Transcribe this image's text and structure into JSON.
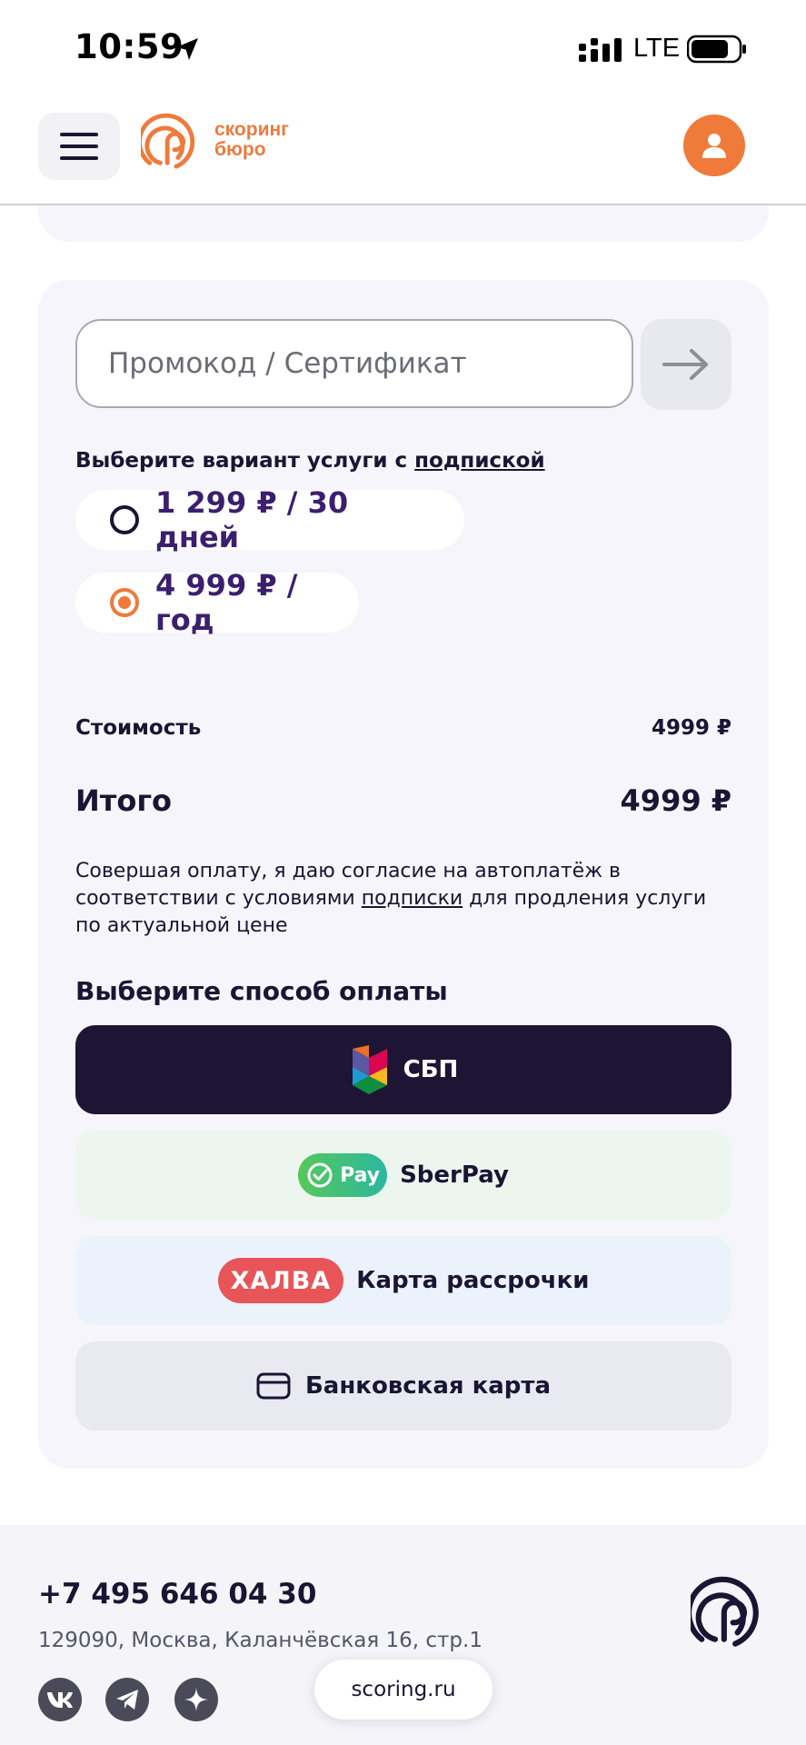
{
  "status_bar": {
    "time": "10:59",
    "network": "LTE"
  },
  "header": {
    "logo_line1": "скоринг",
    "logo_line2": "бюро"
  },
  "promo": {
    "placeholder": "Промокод / Сертификат"
  },
  "plans": {
    "label_prefix": "Выберите вариант услуги с ",
    "label_link": "подпиской",
    "options": [
      {
        "label": "1 299 ₽ / 30 дней",
        "selected": false
      },
      {
        "label": "4 999 ₽ / год",
        "selected": true
      }
    ]
  },
  "summary": {
    "cost_label": "Стоимость",
    "cost_value": "4999 ₽",
    "total_label": "Итого",
    "total_value": "4999 ₽"
  },
  "consent": {
    "part1": "Совершая оплату, я даю согласие на автоплатёж в соответствии с условиями ",
    "link": "подписки",
    "part2": " для продления услуги по актуальной цене"
  },
  "payment": {
    "title": "Выберите способ оплаты",
    "sbp_label": "СБП",
    "sberpay_badge": "Pay",
    "sberpay_label": "SberPay",
    "halva_badge": "ХАЛВА",
    "halva_label": "Карта рассрочки",
    "card_label": "Банковская карта"
  },
  "footer": {
    "phone": "+7 495 646 04 30",
    "address": "129090, Москва, Каланчёвская 16, стр.1"
  },
  "browser": {
    "url": "scoring.ru"
  },
  "colors": {
    "accent": "#ef7a3a",
    "primary_dark": "#1e1535",
    "plan_text": "#3b1f6e"
  }
}
